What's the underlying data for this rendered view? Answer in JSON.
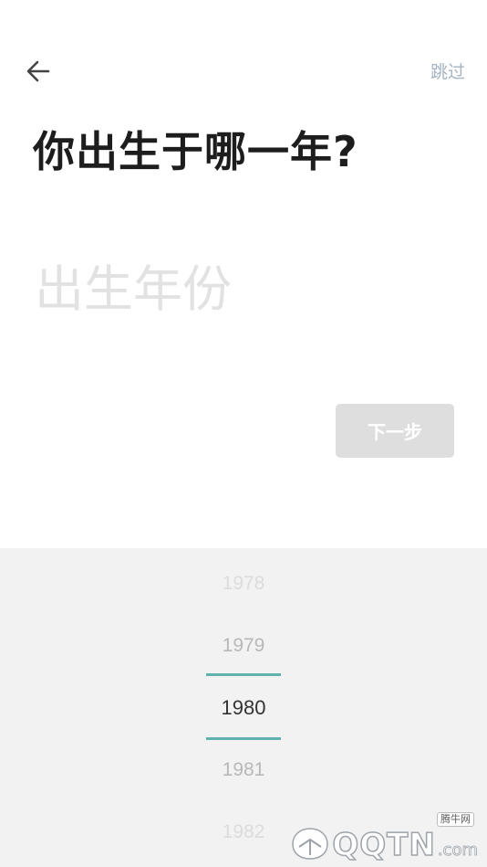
{
  "header": {
    "skip_label": "跳过"
  },
  "main": {
    "title": "你出生于哪一年?",
    "input_placeholder": "出生年份",
    "next_label": "下一步"
  },
  "picker": {
    "years": [
      "1978",
      "1979",
      "1980",
      "1981",
      "1982"
    ],
    "selected": "1980"
  },
  "watermark": {
    "tag": "腾牛网",
    "logo": "QQTN",
    "suffix": ".com"
  },
  "colors": {
    "accent": "#5fb3ac",
    "skip": "#a4b3c2",
    "title": "#1d1d1d",
    "button_bg": "#dedede",
    "picker_bg": "#f2f2f2"
  }
}
